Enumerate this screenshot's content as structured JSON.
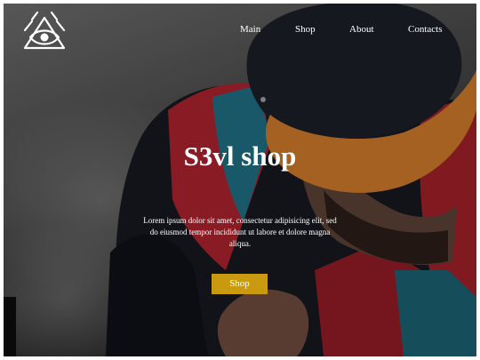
{
  "logo": {
    "icon": "eye-triangle-logo-icon"
  },
  "nav": {
    "items": [
      {
        "label": "Main"
      },
      {
        "label": "Shop"
      },
      {
        "label": "About"
      },
      {
        "label": "Contacts"
      }
    ]
  },
  "hero": {
    "title": "S3vl shop",
    "text": "Lorem ipsum dolor sit amet, consectetur adipisicing elit, sed do eiusmod tempor incididunt ut labore et dolore magna aliqua.",
    "button_label": "Shop"
  },
  "colors": {
    "accent": "#c9990f",
    "text": "#ffffff",
    "cap": "#1a1f27",
    "cap_brim": "#c9772a",
    "jacket_red": "#a8222c",
    "jacket_teal": "#1f6c80"
  }
}
